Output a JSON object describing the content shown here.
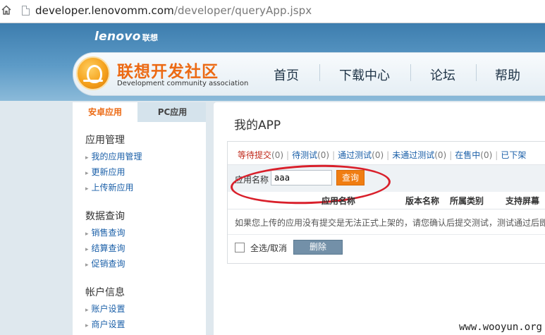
{
  "address_bar": {
    "url_host": "developer.lenovomm.com",
    "url_path": "/developer/queryApp.jspx"
  },
  "header": {
    "brand": "lenovo",
    "brand_cn": "联想",
    "logo_title": "联想开发社区",
    "logo_subtitle": "Development community association",
    "nav": [
      "首页",
      "下载中心",
      "论坛",
      "帮助"
    ]
  },
  "sidebar": {
    "tabs": [
      "安卓应用",
      "PC应用"
    ],
    "sections": [
      {
        "heading": "应用管理",
        "links": [
          "我的应用管理",
          "更新应用",
          "上传新应用"
        ]
      },
      {
        "heading": "数据查询",
        "links": [
          "销售查询",
          "结算查询",
          "促销查询"
        ]
      },
      {
        "heading": "帐户信息",
        "links": [
          "账户设置",
          "商户设置"
        ]
      }
    ]
  },
  "main": {
    "title": "我的APP",
    "status_tabs": [
      {
        "label": "等待提交",
        "count": "(0)"
      },
      {
        "label": "待测试",
        "count": "(0)"
      },
      {
        "label": "通过测试",
        "count": "(0)"
      },
      {
        "label": "未通过测试",
        "count": "(0)"
      },
      {
        "label": "在售中",
        "count": "(0)"
      },
      {
        "label": "已下架",
        "count": ""
      }
    ],
    "search": {
      "label": "应用名称",
      "value": "aaa",
      "button": "查询"
    },
    "table_headers": [
      "应用名称",
      "版本名称",
      "所属类别",
      "支持屏幕"
    ],
    "notice": "如果您上传的应用没有提交是无法正式上架的，请您确认后提交测试，测试通过后即",
    "select_all": "全选/取消",
    "delete_button": "删除"
  },
  "watermark": "www.wooyun.org",
  "colors": {
    "accent": "#ec6a14",
    "link": "#1a5fa8",
    "highlight_oval": "#d9202b"
  }
}
